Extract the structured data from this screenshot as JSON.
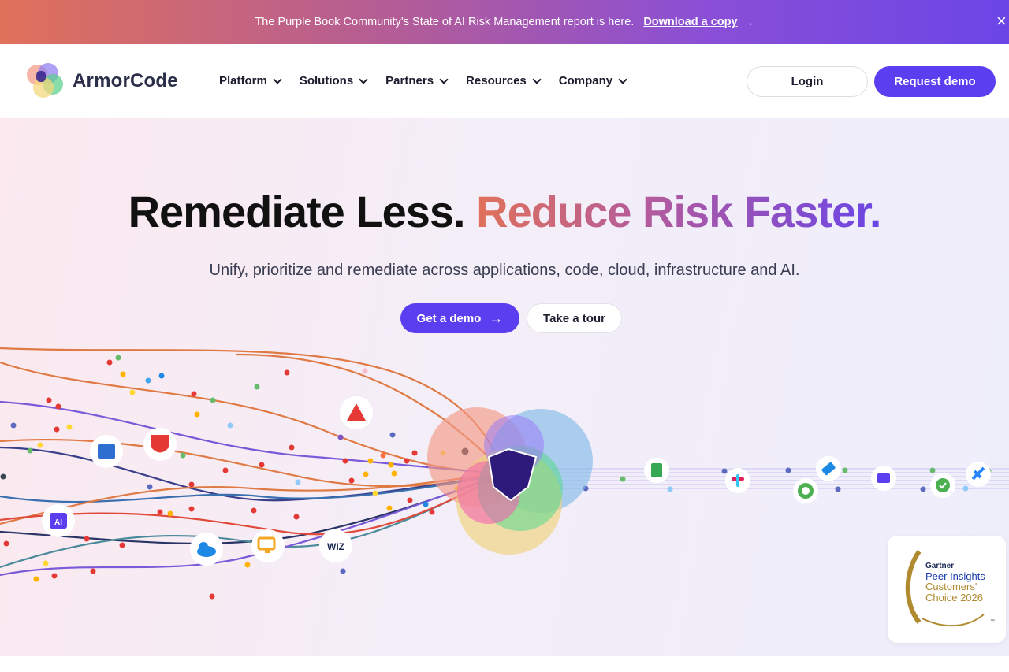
{
  "announcement": {
    "message": "The Purple Book Community’s State of AI Risk Management report is here.",
    "link": "Download a copy",
    "arrow": "→",
    "close": "×"
  },
  "brand": {
    "name": "ArmorCode"
  },
  "nav": {
    "items": [
      {
        "label": "Platform"
      },
      {
        "label": "Solutions"
      },
      {
        "label": "Partners"
      },
      {
        "label": "Resources"
      },
      {
        "label": "Company"
      }
    ],
    "login": "Login",
    "request_demo": "Request demo"
  },
  "hero": {
    "headline_plain": "Remediate Less.",
    "headline_gradient": "Reduce Risk Faster.",
    "subhead": "Unify, prioritize and remediate across applications, code, cloud, infrastructure and AI.",
    "cta_primary": "Get a demo",
    "cta_primary_arrow": "→",
    "cta_secondary": "Take a tour"
  },
  "integration_icons": [
    "chip-icon",
    "qualys-icon",
    "warning-icon",
    "ai-chip-icon",
    "cloud-icon",
    "monitor-icon",
    "wiz-logo",
    "sheets-icon",
    "slack-icon",
    "ring-icon",
    "tag-icon",
    "form-icon",
    "check-icon",
    "jira-icon"
  ],
  "wiz_label": "WIZ",
  "ai_label": "AI",
  "award": {
    "vendor": "Gartner",
    "line1": "Peer Insights",
    "line2": "Customers'",
    "line3": "Choice 2026",
    "tm": "™"
  },
  "colors": {
    "accent": "#5b3ef0",
    "brand_text": "#2b2f4a"
  }
}
